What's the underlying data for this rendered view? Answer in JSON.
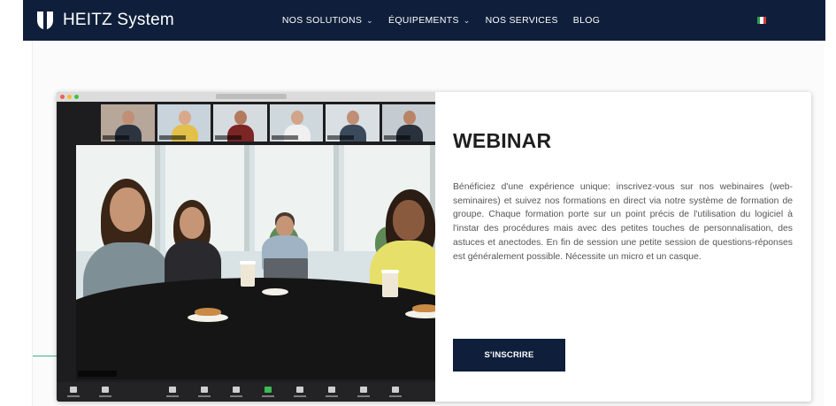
{
  "header": {
    "brand": "HEITZ System",
    "nav": [
      {
        "label": "NOS SOLUTIONS",
        "has_dropdown": true
      },
      {
        "label": "ÉQUIPEMENTS",
        "has_dropdown": true
      },
      {
        "label": "NOS SERVICES",
        "has_dropdown": false
      },
      {
        "label": "BLOG",
        "has_dropdown": false
      }
    ],
    "chevron": "⌄",
    "language_flag": {
      "name": "italian-flag-icon",
      "colors": [
        "#2e9a48",
        "#ffffff",
        "#d33a3a"
      ]
    }
  },
  "card": {
    "title": "WEBINAR",
    "description": "Bénéficiez d'une expérience unique: inscrivez-vous sur nos webinaires (web-seminaires) et suivez nos formations en direct via notre système de formation de groupe. Chaque formation porte sur un point précis de l'utilisation du logiciel à l'instar des procédures mais avec des petites touches de personnalisation, des astuces et anectodes. En fin de session une petite session de questions-réponses est généralement possible. Nécessite un micro et un casque.",
    "button_label": "S'INSCRIRE"
  },
  "colors": {
    "navy": "#0f1f3b",
    "accent_green": "#3fae8f"
  }
}
